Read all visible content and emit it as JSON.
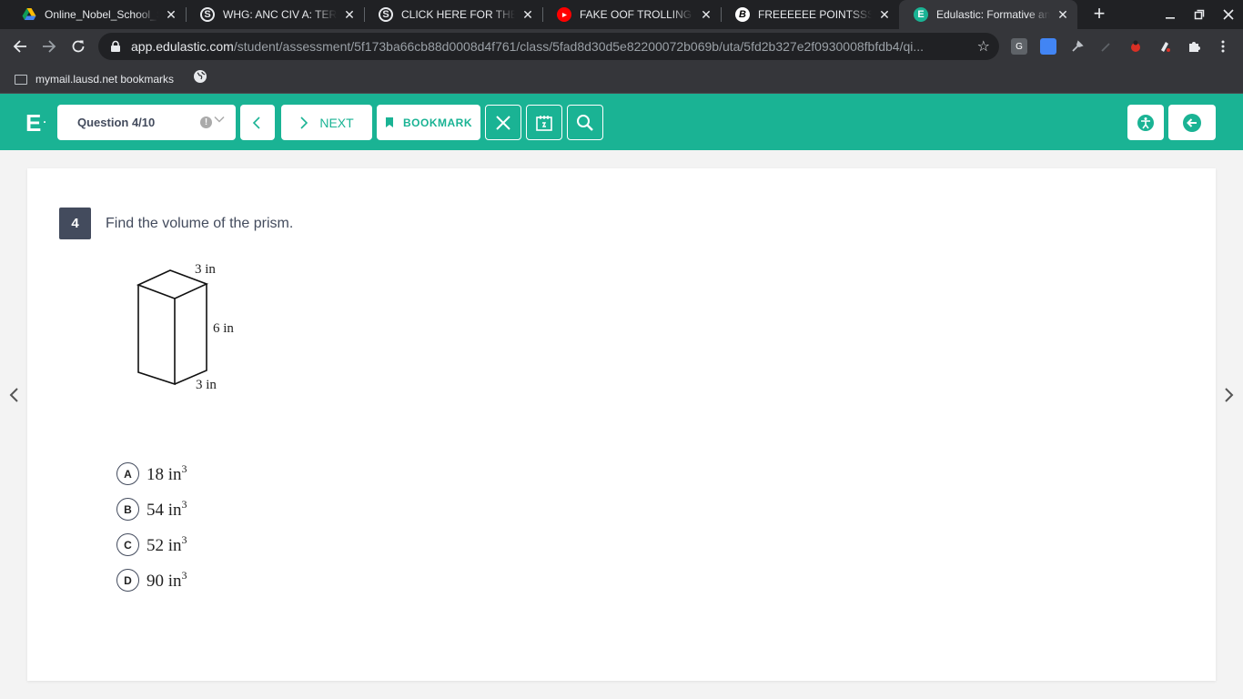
{
  "browser": {
    "tabs": [
      {
        "title": "Online_Nobel_School_Sc",
        "icon": "drive-icon"
      },
      {
        "title": "WHG: ANC CIV A: TERM",
        "icon": "s-icon"
      },
      {
        "title": "CLICK HERE FOR THE ZC",
        "icon": "s-icon"
      },
      {
        "title": "FAKE OOF TROLLING IN",
        "icon": "youtube-icon"
      },
      {
        "title": "FREEEEEE POINTSSSSS",
        "icon": "b-icon"
      },
      {
        "title": "Edulastic: Formative and",
        "icon": "edulastic-icon",
        "active": true
      }
    ],
    "url_host": "app.edulastic.com",
    "url_path": "/student/assessment/5f173ba66cb88d0008d4f761/class/5fad8d30d5e82200072b069b/uta/5fd2b327e2f0930008fbfdb4/qi...",
    "bookmarks": [
      {
        "label": "mymail.lausd.net bookmarks"
      }
    ]
  },
  "app": {
    "logo": "E",
    "question_select": "Question 4/10",
    "next_label": "NEXT",
    "bookmark_label": "BOOKMARK",
    "brand_color": "#1ab394"
  },
  "question": {
    "number": "4",
    "text": "Find the volume of the prism.",
    "figure_labels": {
      "top": "3 in",
      "height": "6 in",
      "bottom": "3 in"
    },
    "options": [
      {
        "letter": "A",
        "value": "18 in",
        "exp": "3"
      },
      {
        "letter": "B",
        "value": "54 in",
        "exp": "3"
      },
      {
        "letter": "C",
        "value": "52 in",
        "exp": "3"
      },
      {
        "letter": "D",
        "value": "90 in",
        "exp": "3"
      }
    ]
  }
}
